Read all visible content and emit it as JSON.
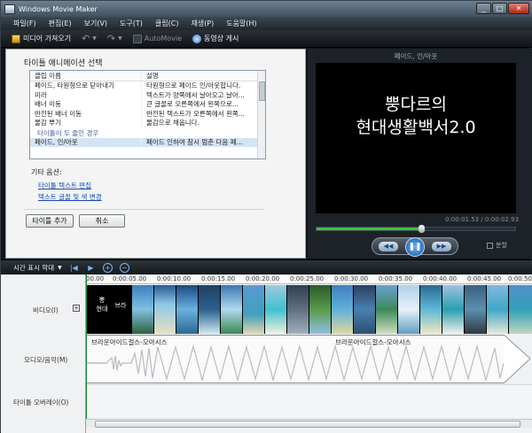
{
  "window": {
    "title": "Windows Movie Maker",
    "controls": [
      "_",
      "□",
      "✕"
    ]
  },
  "menu": [
    "파일(F)",
    "편집(E)",
    "보기(V)",
    "도구(T)",
    "클립(C)",
    "재생(P)",
    "도움말(H)"
  ],
  "toolbar": {
    "import_label": "미디어 가져오기",
    "automovie_label": "AutoMovie",
    "publish_label": "동영상 게시",
    "undo_glyph": "↶",
    "redo_glyph": "↷"
  },
  "title_panel": {
    "heading": "타이틀 애니메이션 선택",
    "col_name": "클립 이름",
    "col_desc": "설명",
    "rows": [
      {
        "name": "페이드, 타원형으로 닫아내기",
        "desc": "타원형으로 페이드 인/아웃합니다."
      },
      {
        "name": "미러",
        "desc": "텍스트가 양쪽에서 날아오고 날아..."
      },
      {
        "name": "배너 이동",
        "desc": "큰 글꼴로 오른쪽에서 왼쪽으로..."
      },
      {
        "name": "반전된 배너 이동",
        "desc": "반전된 텍스트가 오른쪽에서 왼쪽..."
      },
      {
        "name": "물감 뿌기",
        "desc": "물감으로 채웁니다."
      }
    ],
    "group_label": "타이틀이 두 줄인 경우",
    "selected_row": {
      "name": "페이드, 인/아웃",
      "desc": "페이드 인하여 잠시 멈춘 다음 페..."
    },
    "other_options": "기타 옵션:",
    "link_edit_text": "타이틀 텍스트 편집",
    "link_font_color": "텍스트 글꼴 및 색 변경",
    "add_title": "타이틀 추가",
    "cancel": "취소"
  },
  "preview": {
    "label": "페이드, 인/아웃",
    "line1": "뿡다르의",
    "line2": "현대생활백서2.0",
    "time": "0:00:01.53 / 0:00:02.93",
    "progress": 0.52,
    "prev_glyph": "◀◀",
    "pause_glyph": "❚❚",
    "next_glyph": "▶▶",
    "split_label": "분할"
  },
  "timeline": {
    "bar_label": "시간 표시 막대",
    "tracks": {
      "video": "비디오(I)",
      "audio": "오디오/음악(M)",
      "overlay": "타이틀 오버레이(O)"
    },
    "ruler": [
      "00.00",
      "0:00:05.00",
      "0:00:10.00",
      "0:00:15.00",
      "0:00:20.00",
      "0:00:25.00",
      "0:00:30.00",
      "0:00:35.00",
      "0:00:40.00",
      "0:00:45.00",
      "0:00:50."
    ],
    "title_clip_1": "뿡\n현대",
    "title_clip_2": "브라",
    "audio_clip_1": "브라운아이드걸스-오아시스",
    "audio_clip_2": "브라운아이드걸스-오아시스",
    "expand_glyph": "⊞"
  },
  "colors": {
    "accent": "#39c440",
    "link": "#1a4ab8"
  }
}
